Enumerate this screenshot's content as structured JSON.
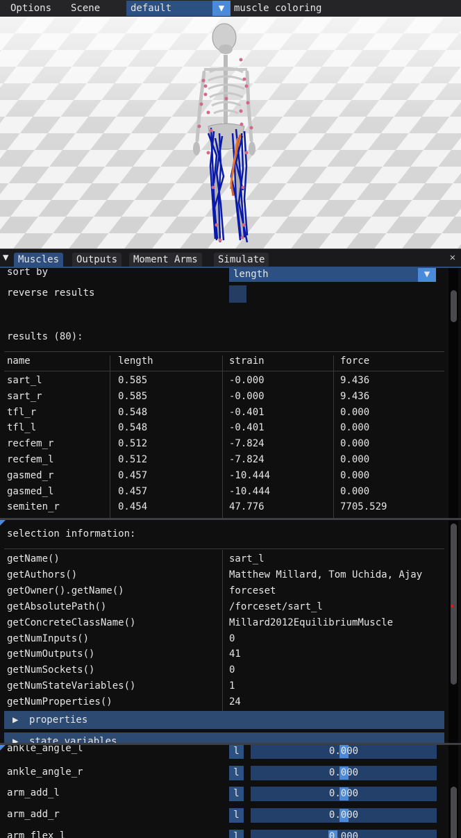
{
  "menubar": {
    "options": "Options",
    "scene": "Scene",
    "preset_value": "default",
    "coloring_label": "muscle coloring"
  },
  "tabs": [
    "Muscles",
    "Outputs",
    "Moment Arms",
    "Simulate"
  ],
  "close_glyph": "✕",
  "muscles": {
    "sort_by_label": "sort by",
    "sort_by_value": "length",
    "reverse_label": "reverse results",
    "results_label": "results (80):",
    "columns": [
      "name",
      "length",
      "strain",
      "force"
    ],
    "rows": [
      [
        "sart_l",
        "0.585",
        "-0.000",
        "9.436"
      ],
      [
        "sart_r",
        "0.585",
        "-0.000",
        "9.436"
      ],
      [
        "tfl_r",
        "0.548",
        "-0.401",
        "0.000"
      ],
      [
        "tfl_l",
        "0.548",
        "-0.401",
        "0.000"
      ],
      [
        "recfem_r",
        "0.512",
        "-7.824",
        "0.000"
      ],
      [
        "recfem_l",
        "0.512",
        "-7.824",
        "0.000"
      ],
      [
        "gasmed_r",
        "0.457",
        "-10.444",
        "0.000"
      ],
      [
        "gasmed_l",
        "0.457",
        "-10.444",
        "0.000"
      ],
      [
        "semiten_r",
        "0.454",
        "47.776",
        "7705.529"
      ]
    ]
  },
  "selection": {
    "title": "selection information:",
    "rows": [
      [
        "getName()",
        "sart_l"
      ],
      [
        "getAuthors()",
        "Matthew Millard, Tom Uchida, Ajay"
      ],
      [
        "getOwner().getName()",
        "forceset"
      ],
      [
        "getAbsolutePath()",
        "/forceset/sart_l"
      ],
      [
        "getConcreteClassName()",
        "Millard2012EquilibriumMuscle"
      ],
      [
        "getNumInputs()",
        "0"
      ],
      [
        "getNumOutputs()",
        "41"
      ],
      [
        "getNumSockets()",
        "0"
      ],
      [
        "getNumStateVariables()",
        "1"
      ],
      [
        "getNumProperties()",
        "24"
      ]
    ],
    "properties_label": "properties",
    "state_variables_label": "state variables"
  },
  "coordinates": {
    "rows": [
      {
        "name": "ankle_angle_l",
        "lock": "l",
        "value": "0.000",
        "level": 0.5
      },
      {
        "name": "ankle_angle_r",
        "lock": "l",
        "value": "0.000",
        "level": 0.5
      },
      {
        "name": "arm_add_l",
        "lock": "l",
        "value": "0.000",
        "level": 0.5
      },
      {
        "name": "arm_add_r",
        "lock": "l",
        "value": "0.000",
        "level": 0.5
      },
      {
        "name": "arm_flex_l",
        "lock": "l",
        "value": "0.000",
        "level": 0.44
      }
    ]
  },
  "colors": {
    "accent": "#4a8ad8",
    "frame": "#2c5082",
    "muscle_blue": "#0a1aa8",
    "muscle_selected": "#d4622a"
  }
}
